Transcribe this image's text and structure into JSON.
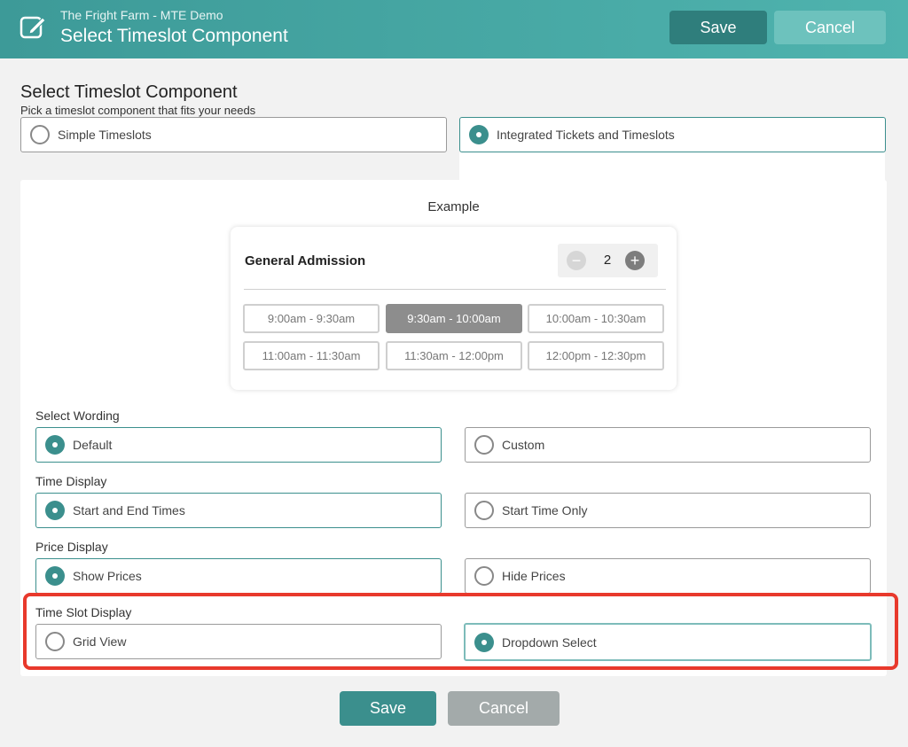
{
  "header": {
    "subtitle": "The Fright Farm - MTE Demo",
    "title": "Select Timeslot Component",
    "save_label": "Save",
    "cancel_label": "Cancel",
    "icon": "edit-icon"
  },
  "page": {
    "title": "Select Timeslot Component",
    "description": "Pick a timeslot component that fits your needs"
  },
  "component_options": {
    "simple": "Simple Timeslots",
    "integrated": "Integrated Tickets and Timeslots",
    "selected": "integrated"
  },
  "example": {
    "label": "Example",
    "ticket_name": "General Admission",
    "quantity": "2",
    "slots": [
      "9:00am - 9:30am",
      "9:30am - 10:00am",
      "10:00am - 10:30am",
      "11:00am - 11:30am",
      "11:30am - 12:00pm",
      "12:00pm - 12:30pm"
    ],
    "active_slot": "9:30am - 10:00am"
  },
  "settings": {
    "wording": {
      "label": "Select Wording",
      "options": [
        "Default",
        "Custom"
      ],
      "selected": "Default"
    },
    "time_display": {
      "label": "Time Display",
      "options": [
        "Start and End Times",
        "Start Time Only"
      ],
      "selected": "Start and End Times"
    },
    "price_display": {
      "label": "Price Display",
      "options": [
        "Show Prices",
        "Hide Prices"
      ],
      "selected": "Show Prices"
    },
    "slot_display": {
      "label": "Time Slot Display",
      "options": [
        "Grid View",
        "Dropdown Select"
      ],
      "selected": "Dropdown Select"
    }
  },
  "footer": {
    "save_label": "Save",
    "cancel_label": "Cancel"
  },
  "colors": {
    "accent": "#3b8f8d",
    "header": "#4fb3ae",
    "highlight": "#e8392c"
  }
}
